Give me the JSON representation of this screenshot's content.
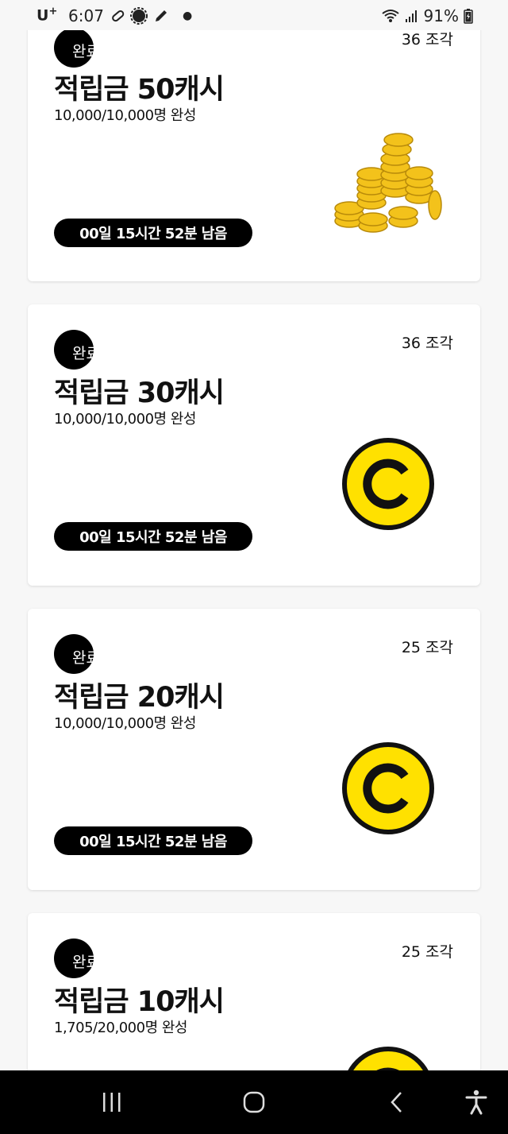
{
  "status_bar": {
    "carrier": "U",
    "carrier_sup": "+",
    "time": "6:07",
    "battery": "91%"
  },
  "cards": [
    {
      "status": "완료",
      "pieces": "36 조각",
      "title": "적립금 50캐시",
      "progress": "10,000/10,000명 완성",
      "timer": "00일 15시간 52분 남음",
      "image": "gold-coins-pile"
    },
    {
      "status": "완료",
      "pieces": "36 조각",
      "title": "적립금 30캐시",
      "progress": "10,000/10,000명 완성",
      "timer": "00일 15시간 52분 남음",
      "image": "yellow-cash-coin"
    },
    {
      "status": "완료",
      "pieces": "25 조각",
      "title": "적립금 20캐시",
      "progress": "10,000/10,000명 완성",
      "timer": "00일 15시간 52분 남음",
      "image": "yellow-cash-coin"
    },
    {
      "status": "완료",
      "pieces": "25 조각",
      "title": "적립금 10캐시",
      "progress": "1,705/20,000명 완성",
      "image": "yellow-cash-coin"
    }
  ],
  "colors": {
    "background": "#f7f7f7",
    "card": "#ffffff",
    "badge": "#000000",
    "coin_yellow": "#ffe100",
    "nav_bar": "#000000"
  }
}
